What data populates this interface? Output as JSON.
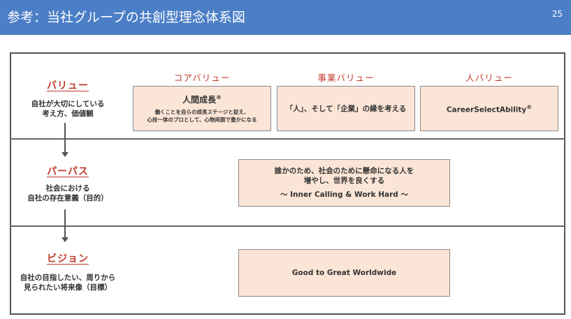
{
  "header": {
    "title": "参考：当社グループの共創型理念体系図",
    "page_number": "25"
  },
  "value": {
    "title": "バリュー",
    "desc": [
      "自社が大切にしている",
      "考え方、価値観"
    ],
    "columns": [
      {
        "head": "コアバリュー",
        "main": "人間成長",
        "mark": "®",
        "sub": [
          "働くことを自らの成長ステージと捉え、",
          "心技一体のプロとして、心物両面で豊かになる"
        ]
      },
      {
        "head": "事業バリュー",
        "main": "「人」、そして「企業」の縁を考える"
      },
      {
        "head": "人バリュー",
        "main": "CareerSelectAbility",
        "mark": "®"
      }
    ]
  },
  "purpose": {
    "title": "パーパス",
    "desc": [
      "社会における",
      "自社の存在意義（目的）"
    ],
    "text": [
      "誰かのため、社会のために懸命になる人を",
      "増やし、世界を良くする"
    ],
    "tagline": "～ Inner Calling & Work Hard ～"
  },
  "vision": {
    "title": "ビジョン",
    "desc": [
      "自社の目指したい、周りから",
      "見られたい将来像（目標）"
    ],
    "text": "Good to Great Worldwide"
  },
  "colors": {
    "header": "#4a7ec6",
    "accent": "#c0392b",
    "box_fill": "#fbe5d6"
  }
}
